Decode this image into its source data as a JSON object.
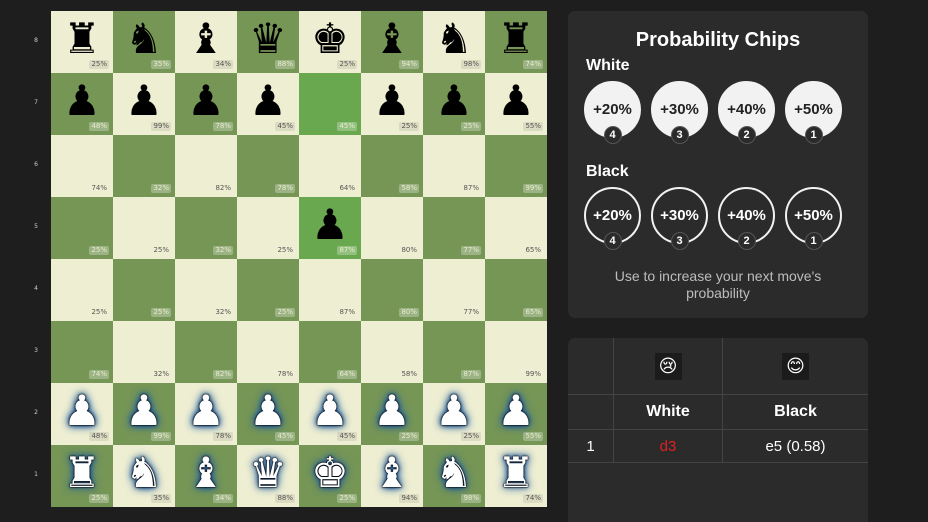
{
  "board": {
    "rank_labels": [
      "8",
      "7",
      "6",
      "5",
      "4",
      "3",
      "2",
      "1"
    ],
    "rows": [
      [
        {
          "p": "♜",
          "c": "b",
          "v": "25%"
        },
        {
          "p": "♞",
          "c": "b",
          "v": "35%"
        },
        {
          "p": "♝",
          "c": "b",
          "v": "34%"
        },
        {
          "p": "♛",
          "c": "b",
          "v": "88%"
        },
        {
          "p": "♚",
          "c": "b",
          "v": "25%"
        },
        {
          "p": "♝",
          "c": "b",
          "v": "94%"
        },
        {
          "p": "♞",
          "c": "b",
          "v": "98%"
        },
        {
          "p": "♜",
          "c": "b",
          "v": "74%"
        }
      ],
      [
        {
          "p": "♟",
          "c": "b",
          "v": "48%"
        },
        {
          "p": "♟",
          "c": "b",
          "v": "99%"
        },
        {
          "p": "♟",
          "c": "b",
          "v": "78%"
        },
        {
          "p": "♟",
          "c": "b",
          "v": "45%"
        },
        {
          "p": "",
          "c": "",
          "v": "45%",
          "hl": true
        },
        {
          "p": "♟",
          "c": "b",
          "v": "25%"
        },
        {
          "p": "♟",
          "c": "b",
          "v": "25%"
        },
        {
          "p": "♟",
          "c": "b",
          "v": "55%"
        }
      ],
      [
        {
          "p": "",
          "c": "",
          "v": "74%"
        },
        {
          "p": "",
          "c": "",
          "v": "32%"
        },
        {
          "p": "",
          "c": "",
          "v": "82%"
        },
        {
          "p": "",
          "c": "",
          "v": "78%"
        },
        {
          "p": "",
          "c": "",
          "v": "64%"
        },
        {
          "p": "",
          "c": "",
          "v": "58%"
        },
        {
          "p": "",
          "c": "",
          "v": "87%"
        },
        {
          "p": "",
          "c": "",
          "v": "99%"
        }
      ],
      [
        {
          "p": "",
          "c": "",
          "v": "25%"
        },
        {
          "p": "",
          "c": "",
          "v": "25%"
        },
        {
          "p": "",
          "c": "",
          "v": "32%"
        },
        {
          "p": "",
          "c": "",
          "v": "25%"
        },
        {
          "p": "♟",
          "c": "b",
          "v": "87%",
          "hl": true
        },
        {
          "p": "",
          "c": "",
          "v": "80%"
        },
        {
          "p": "",
          "c": "",
          "v": "77%"
        },
        {
          "p": "",
          "c": "",
          "v": "65%"
        }
      ],
      [
        {
          "p": "",
          "c": "",
          "v": "25%"
        },
        {
          "p": "",
          "c": "",
          "v": "25%"
        },
        {
          "p": "",
          "c": "",
          "v": "32%"
        },
        {
          "p": "",
          "c": "",
          "v": "25%"
        },
        {
          "p": "",
          "c": "",
          "v": "87%"
        },
        {
          "p": "",
          "c": "",
          "v": "80%"
        },
        {
          "p": "",
          "c": "",
          "v": "77%"
        },
        {
          "p": "",
          "c": "",
          "v": "65%"
        }
      ],
      [
        {
          "p": "",
          "c": "",
          "v": "74%"
        },
        {
          "p": "",
          "c": "",
          "v": "32%"
        },
        {
          "p": "",
          "c": "",
          "v": "82%"
        },
        {
          "p": "",
          "c": "",
          "v": "78%"
        },
        {
          "p": "",
          "c": "",
          "v": "64%"
        },
        {
          "p": "",
          "c": "",
          "v": "58%"
        },
        {
          "p": "",
          "c": "",
          "v": "87%"
        },
        {
          "p": "",
          "c": "",
          "v": "99%"
        }
      ],
      [
        {
          "p": "♟",
          "c": "w",
          "v": "48%"
        },
        {
          "p": "♟",
          "c": "w",
          "v": "99%"
        },
        {
          "p": "♟",
          "c": "w",
          "v": "78%"
        },
        {
          "p": "♟",
          "c": "w",
          "v": "45%"
        },
        {
          "p": "♟",
          "c": "w",
          "v": "45%"
        },
        {
          "p": "♟",
          "c": "w",
          "v": "25%"
        },
        {
          "p": "♟",
          "c": "w",
          "v": "25%"
        },
        {
          "p": "♟",
          "c": "w",
          "v": "55%"
        }
      ],
      [
        {
          "p": "♜",
          "c": "w",
          "v": "25%"
        },
        {
          "p": "♞",
          "c": "w",
          "v": "35%"
        },
        {
          "p": "♝",
          "c": "w",
          "v": "34%"
        },
        {
          "p": "♛",
          "c": "w",
          "v": "88%"
        },
        {
          "p": "♚",
          "c": "w",
          "v": "25%"
        },
        {
          "p": "♝",
          "c": "w",
          "v": "94%"
        },
        {
          "p": "♞",
          "c": "w",
          "v": "98%"
        },
        {
          "p": "♜",
          "c": "w",
          "v": "74%"
        }
      ]
    ]
  },
  "chips": {
    "title": "Probability Chips",
    "white_label": "White",
    "black_label": "Black",
    "white": [
      {
        "label": "+20%",
        "count": "4"
      },
      {
        "label": "+30%",
        "count": "3"
      },
      {
        "label": "+40%",
        "count": "2"
      },
      {
        "label": "+50%",
        "count": "1"
      }
    ],
    "black": [
      {
        "label": "+20%",
        "count": "4"
      },
      {
        "label": "+30%",
        "count": "3"
      },
      {
        "label": "+40%",
        "count": "2"
      },
      {
        "label": "+50%",
        "count": "1"
      }
    ],
    "hint": "Use to increase your next move's probability"
  },
  "moves": {
    "white_emoji": "😢",
    "black_emoji": "😊",
    "header_white": "White",
    "header_black": "Black",
    "rows": [
      {
        "num": "1",
        "white": "d3",
        "black": "e5 (0.58)"
      }
    ],
    "colors": {
      "failed_move": "#e02020"
    }
  },
  "colors": {
    "light_square": "#eeeed2",
    "dark_square": "#769656",
    "highlight_square": "#6aa84f",
    "panel": "#2b2b2b",
    "background": "#1e1e1e"
  }
}
